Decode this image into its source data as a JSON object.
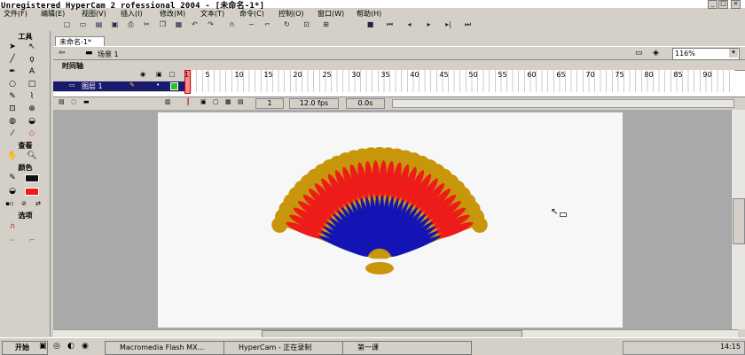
{
  "window": {
    "title": "Unregistered HyperCam 2 rofessional 2004 - [未命名-1*]"
  },
  "menu": [
    "文件(F)",
    "编辑(E)",
    "视图(V)",
    "插入(I)",
    "修改(M)",
    "文本(T)",
    "命令(C)",
    "控制(O)",
    "窗口(W)",
    "帮助(H)"
  ],
  "tools": {
    "header": "工具",
    "view_header": "查看",
    "color_header": "颜色",
    "options_header": "选项"
  },
  "document": {
    "tab": "未命名-1*",
    "scene": "场景 1",
    "zoom": "116%"
  },
  "timeline": {
    "header": "时间轴",
    "layer_name": "图层 1",
    "ruler": [
      "1",
      "5",
      "10",
      "15",
      "20",
      "25",
      "30",
      "35",
      "40",
      "45",
      "50",
      "55",
      "60",
      "65",
      "70",
      "75",
      "80",
      "85",
      "90"
    ],
    "current_frame": "1",
    "fps": "12.0 fps",
    "time": "0.0s"
  },
  "taskbar": {
    "start": "开始",
    "tasks": [
      "Macromedia Flash MX...",
      "HyperCam - 正在录制",
      "第一课"
    ],
    "clock": "14:15"
  },
  "colors": {
    "fan_gold": "#c8960a",
    "fan_red": "#ee1b1b",
    "fan_blue": "#1414b4",
    "stage": "#f7f7f7"
  }
}
